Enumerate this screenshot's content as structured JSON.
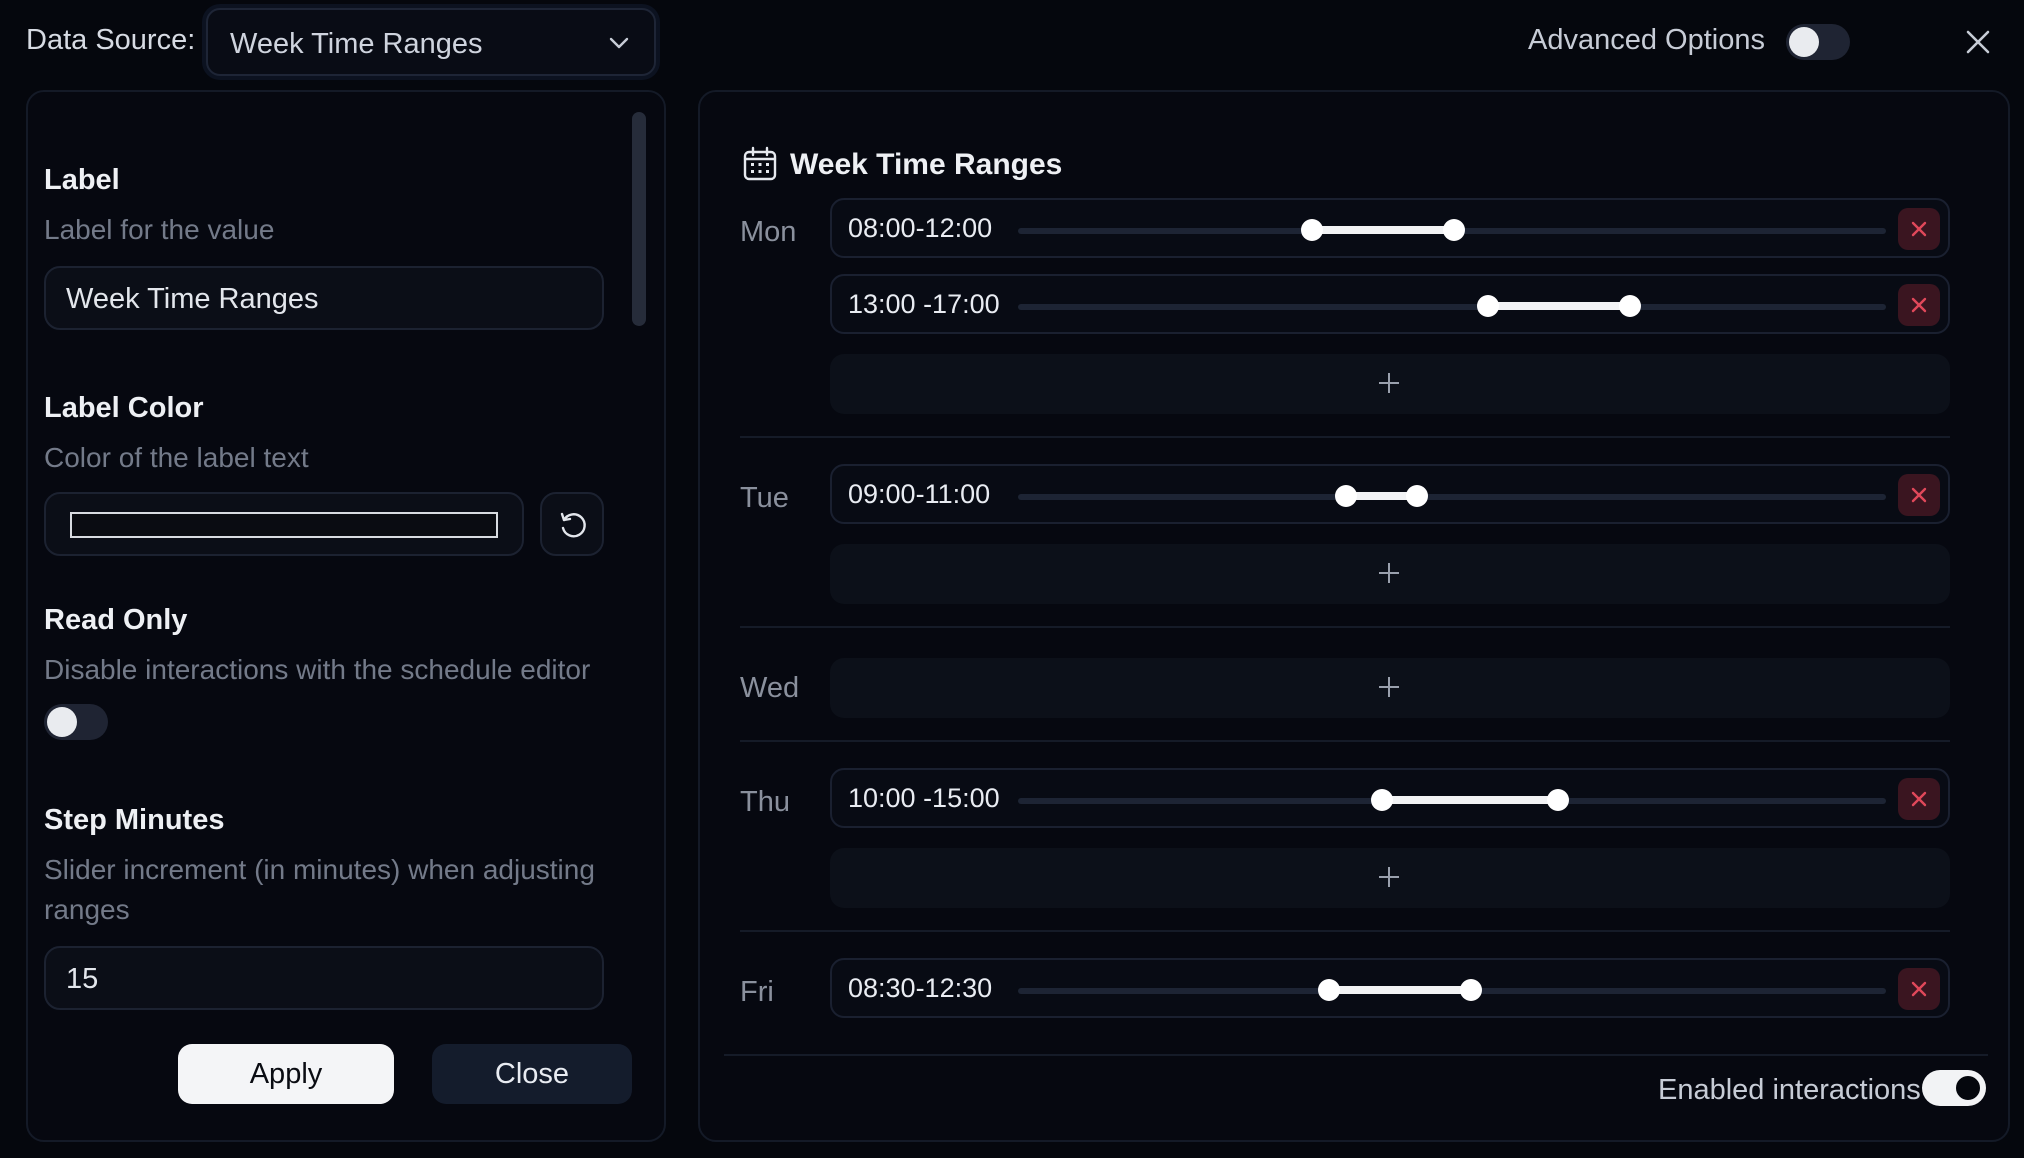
{
  "topbar": {
    "data_source_label": "Data Source:",
    "data_source_value": "Week Time Ranges",
    "advanced_options_label": "Advanced Options",
    "advanced_options_on": false
  },
  "settings": {
    "label": {
      "title": "Label",
      "description": "Label for the value",
      "value": "Week Time Ranges"
    },
    "label_color": {
      "title": "Label Color",
      "description": "Color of the label text",
      "value": "#0a0c12"
    },
    "read_only": {
      "title": "Read Only",
      "description": "Disable interactions with the schedule editor",
      "on": false
    },
    "step_minutes": {
      "title": "Step Minutes",
      "description": "Slider increment (in minutes) when adjusting ranges",
      "value": "15"
    },
    "apply_label": "Apply",
    "close_label": "Close"
  },
  "schedule": {
    "title": "Week Time Ranges",
    "days": [
      {
        "day": "Mon",
        "ranges": [
          "08:00-12:00",
          "13:00 -17:00"
        ]
      },
      {
        "day": "Tue",
        "ranges": [
          "09:00-11:00"
        ]
      },
      {
        "day": "Wed",
        "ranges": []
      },
      {
        "day": "Thu",
        "ranges": [
          "10:00 -15:00"
        ]
      },
      {
        "day": "Fri",
        "ranges": [
          "08:30-12:30"
        ]
      }
    ],
    "enabled_interactions_label": "Enabled interactions",
    "enabled_interactions_on": true
  },
  "colors": {
    "background": "#05070d",
    "panel_border": "#141a27",
    "delete_bg": "#3a1520",
    "delete_icon": "#e0485a",
    "slider_fill": "#f2f3f5"
  },
  "icons": [
    "chevron-down-icon",
    "close-icon",
    "reset-icon",
    "calendar-icon",
    "delete-icon",
    "plus-icon"
  ]
}
